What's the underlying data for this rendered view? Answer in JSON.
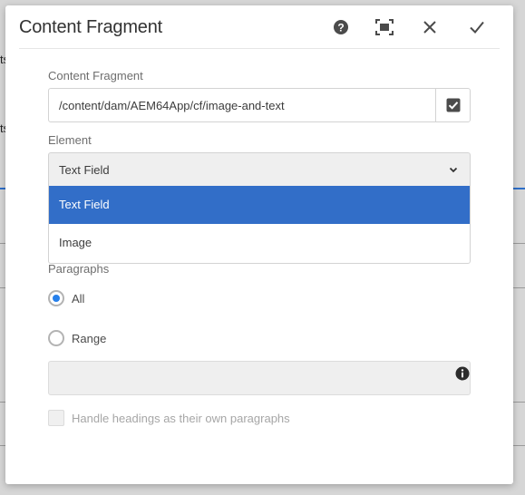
{
  "background": {
    "fragment_a": "ts",
    "fragment_b": "ts"
  },
  "dialog": {
    "title": "Content Fragment",
    "header_icons": [
      "help-icon",
      "fullscreen-icon",
      "close-icon",
      "done-check-icon"
    ]
  },
  "form": {
    "content_fragment": {
      "label": "Content Fragment",
      "value": "/content/dam/AEM64App/cf/image-and-text"
    },
    "element": {
      "label": "Element",
      "selected": "Text Field",
      "options": [
        "Text Field",
        "Image"
      ]
    },
    "paragraphs": {
      "label": "Paragraphs",
      "options": [
        "All",
        "Range"
      ],
      "selected": "All"
    },
    "range_value": "",
    "handle_headings": {
      "label": "Handle headings as their own paragraphs",
      "checked": false
    }
  },
  "colors": {
    "accent": "#326ec8",
    "radio_dot": "#2680eb"
  }
}
